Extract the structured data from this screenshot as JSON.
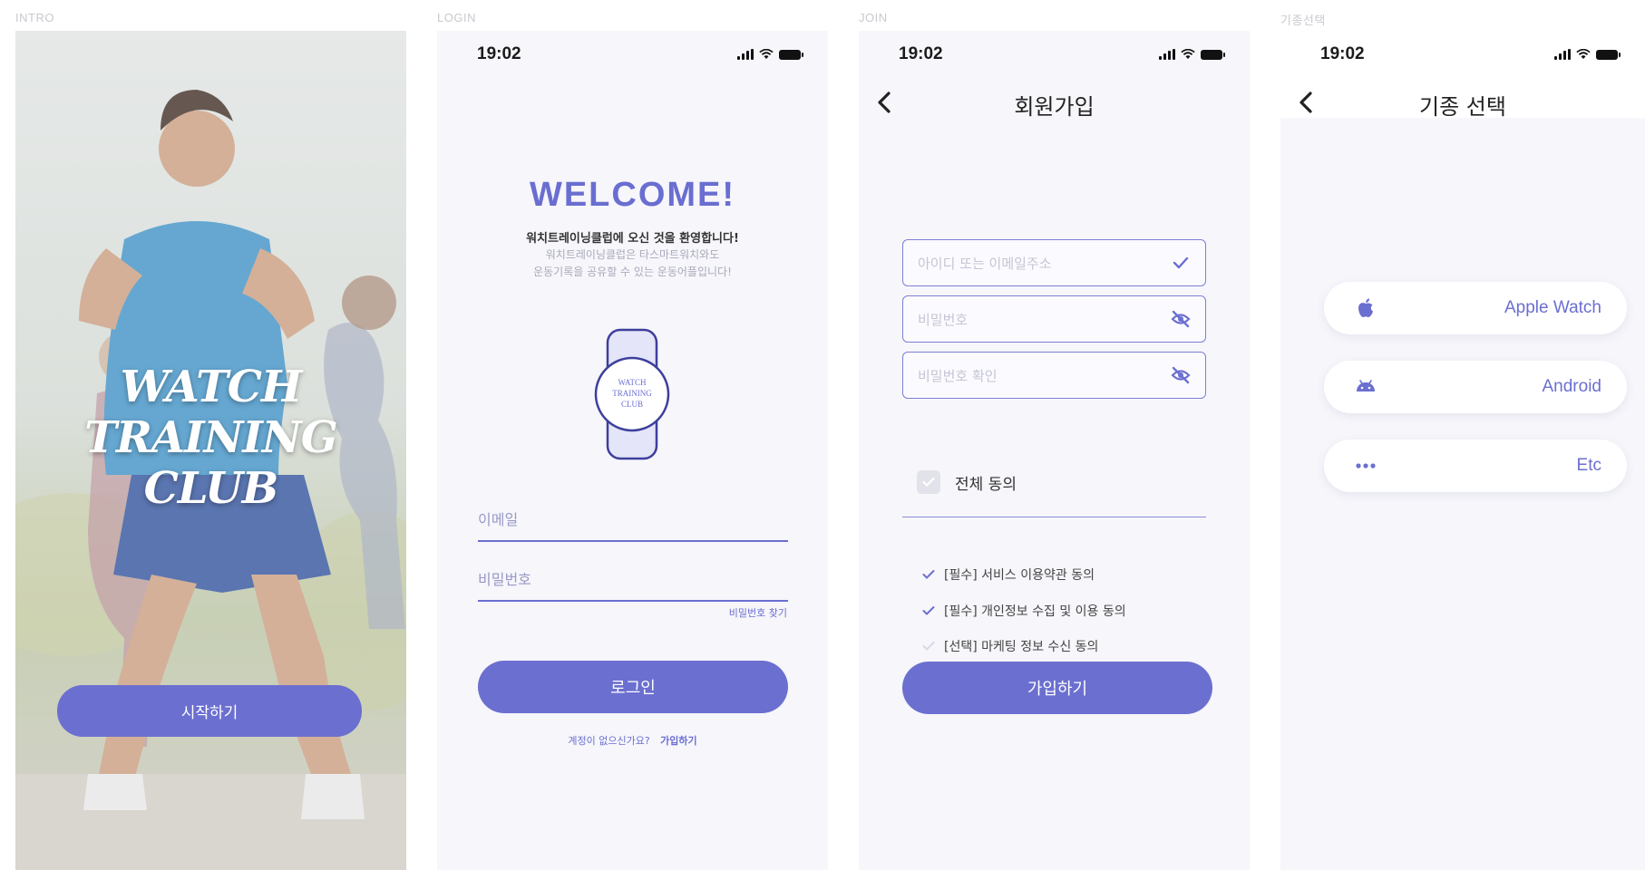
{
  "screens": {
    "intro": {
      "label": "INTRO",
      "title_line1": "WATCH",
      "title_line2": "TRAINING CLUB",
      "start_button": "시작하기"
    },
    "login": {
      "label": "LOGIN",
      "time": "19:02",
      "welcome": "WELCOME!",
      "welcome_sub": "워치트레이닝클럽에 오신 것을 환영합니다!",
      "welcome_desc1": "워치트레이닝클럽은 타스마트워치와도",
      "welcome_desc2": "운동기록을 공유할 수 있는 운동어플입니다!",
      "watch_logo": [
        "WATCH",
        "TRAINING",
        "CLUB"
      ],
      "email_placeholder": "이메일",
      "password_placeholder": "비밀번호",
      "find_password": "비밀번호 찾기",
      "login_button": "로그인",
      "no_account": "계정이 없으신가요?",
      "signup_link": "가입하기"
    },
    "join": {
      "label": "JOIN",
      "time": "19:02",
      "title": "회원가입",
      "id_placeholder": "아이디 또는 이메일주소",
      "password_placeholder": "비밀번호",
      "password_confirm_placeholder": "비밀번호 확인",
      "agree_all": "전체 동의",
      "terms": [
        "[필수] 서비스 이용약관 동의",
        "[필수] 개인정보 수집 및 이용 동의",
        "[선택] 마케팅 정보 수신 동의"
      ],
      "join_button": "가입하기"
    },
    "device": {
      "label": "기종선택",
      "time": "19:02",
      "title": "기종 선택",
      "options": [
        {
          "icon": "apple-icon",
          "label": "Apple Watch"
        },
        {
          "icon": "android-icon",
          "label": "Android"
        },
        {
          "icon": "more-dots-icon",
          "label": "Etc"
        }
      ]
    }
  },
  "colors": {
    "accent": "#6b6fd0",
    "screen_bg": "#f6f6fb",
    "placeholder": "#c4c4d6"
  }
}
